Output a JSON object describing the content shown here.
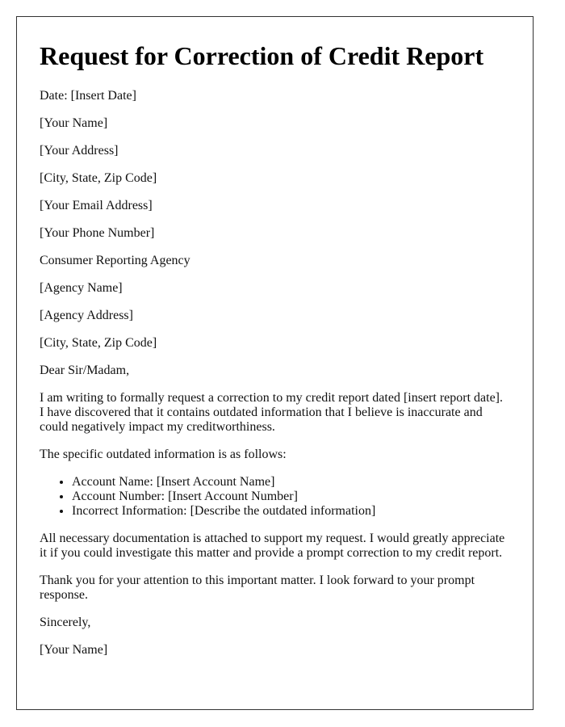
{
  "title": "Request for Correction of Credit Report",
  "date_line": "Date: [Insert Date]",
  "sender": {
    "name": "[Your Name]",
    "address": "[Your Address]",
    "city_state_zip": "[City, State, Zip Code]",
    "email": "[Your Email Address]",
    "phone": "[Your Phone Number]"
  },
  "recipient": {
    "label": "Consumer Reporting Agency",
    "name": "[Agency Name]",
    "address": "[Agency Address]",
    "city_state_zip": "[City, State, Zip Code]"
  },
  "salutation": "Dear Sir/Madam,",
  "body": {
    "intro": "I am writing to formally request a correction to my credit report dated [insert report date]. I have discovered that it contains outdated information that I believe is inaccurate and could negatively impact my creditworthiness.",
    "list_intro": "The specific outdated information is as follows:",
    "items": [
      "Account Name: [Insert Account Name]",
      "Account Number: [Insert Account Number]",
      "Incorrect Information: [Describe the outdated information]"
    ],
    "documentation": "All necessary documentation is attached to support my request. I would greatly appreciate it if you could investigate this matter and provide a prompt correction to my credit report.",
    "thanks": "Thank you for your attention to this important matter. I look forward to your prompt response."
  },
  "closing": "Sincerely,",
  "signature": "[Your Name]"
}
